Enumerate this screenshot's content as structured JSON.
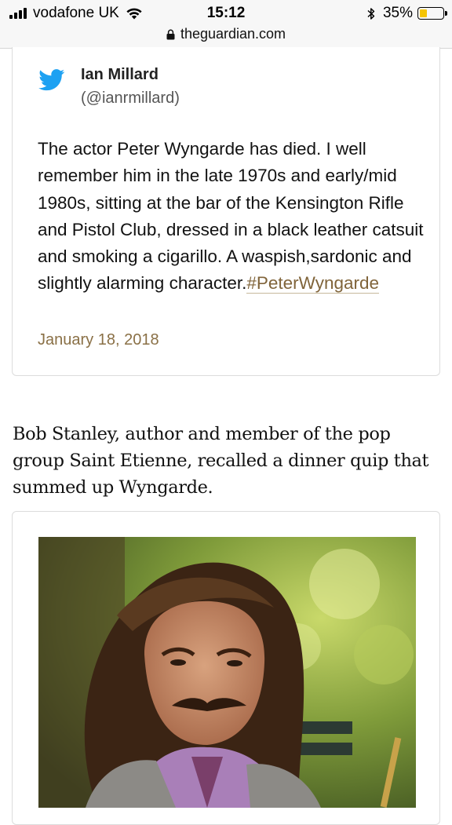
{
  "status_bar": {
    "carrier": "vodafone UK",
    "time": "15:12",
    "battery_percent": "35%",
    "battery_level": 0.35,
    "battery_color": "#f5c400",
    "url": "theguardian.com",
    "icons": [
      "signal-icon",
      "wifi-icon",
      "bluetooth-icon",
      "battery-icon",
      "lock-icon"
    ]
  },
  "tweet": {
    "author_name": "Ian Millard",
    "author_handle": "(@ianrmillard)",
    "text": "The actor Peter Wyngarde has died. I well remember him in the late 1970s and early/mid 1980s, sitting at the bar of the Kensington Rifle and Pistol Club, dressed in a black leather catsuit and smoking a cigarillo. A waspish,sardonic and slightly alarming character.",
    "hashtag": "#PeterWyngarde",
    "date": "January 18, 2018",
    "brand_color": "#1da1f2",
    "link_color": "#80643a"
  },
  "article": {
    "paragraph": "Bob Stanley, author and member of the pop group Saint Etienne, recalled a dinner quip that summed up Wyngarde."
  },
  "embed": {
    "image_kind": "photo"
  }
}
